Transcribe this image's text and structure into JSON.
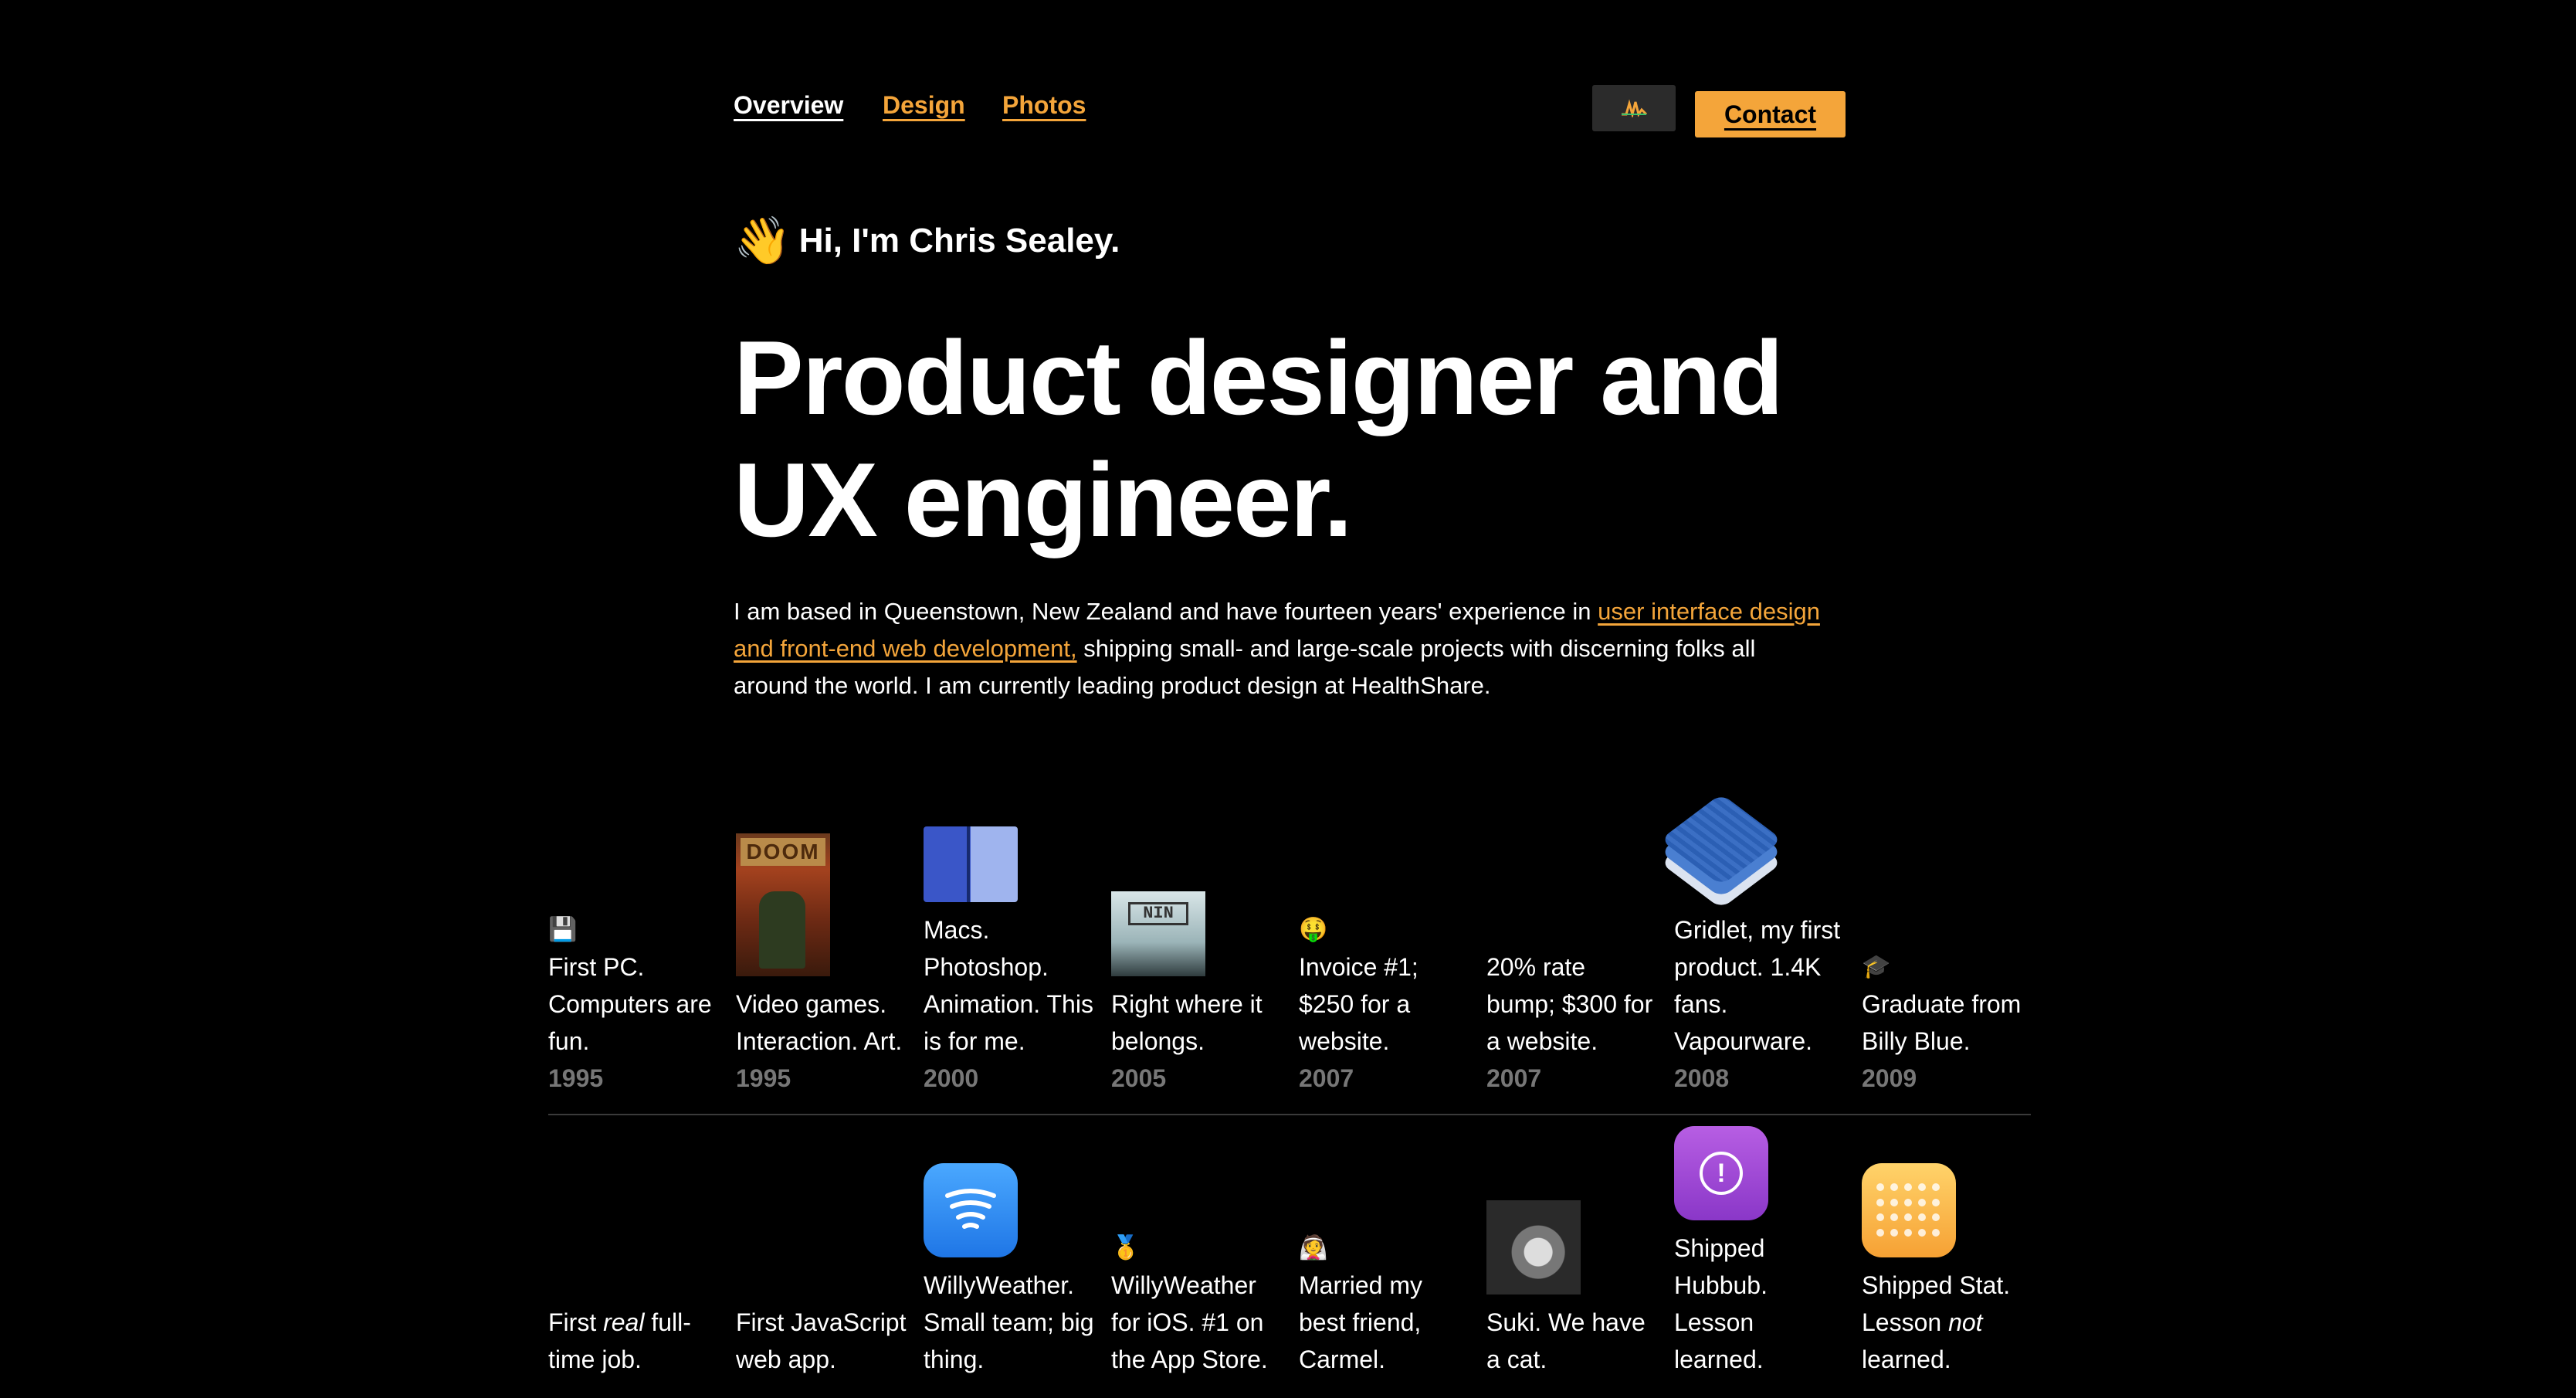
{
  "nav": {
    "items": [
      {
        "label": "Overview"
      },
      {
        "label": "Design"
      },
      {
        "label": "Photos"
      }
    ],
    "contact_label": "Contact"
  },
  "greeting": {
    "emoji": "👋",
    "text": "Hi, I'm Chris Sealey."
  },
  "headline": {
    "line1": "Product designer and",
    "line2": "UX engineer."
  },
  "intro": {
    "before": "I am based in Queenstown, New Zealand and have fourteen years' experience in ",
    "link": "user interface design and front-end web development,",
    "after": " shipping small- and large-scale projects with discerning folks all around the world. I am currently leading product design at HealthShare."
  },
  "timeline_row1": [
    {
      "emoji": "💾",
      "text": "First PC. Computers are fun.",
      "year": "1995"
    },
    {
      "text": "Video games. Interaction. Art.",
      "year": "1995",
      "image": "doom-cover"
    },
    {
      "text": "Macs. Photoshop. Animation. This is for me.",
      "year": "2000",
      "image": "finder-icon"
    },
    {
      "text": "Right where it belongs.",
      "year": "2005",
      "image": "nin-cover"
    },
    {
      "emoji": "🤑",
      "text": "Invoice #1; $250 for a website.",
      "year": "2007"
    },
    {
      "text": "20% rate bump; $300 for a website.",
      "year": "2007"
    },
    {
      "text": "Gridlet, my first product. 1.4K fans. Vapourware.",
      "year": "2008",
      "image": "gridlet-icon"
    },
    {
      "emoji": "🎓",
      "text": "Graduate from Billy Blue.",
      "year": "2009"
    }
  ],
  "timeline_row2": [
    {
      "text_before": "First ",
      "text_em": "real",
      "text_after": " full-time job."
    },
    {
      "text": "First JavaScript web app."
    },
    {
      "text": "WillyWeather. Small team; big thing.",
      "image": "willyweather-icon"
    },
    {
      "emoji": "🥇",
      "text": "WillyWeather for iOS. #1 on the App Store."
    },
    {
      "emoji": "👰",
      "text": "Married my best friend, Carmel."
    },
    {
      "text": "Suki. We have a cat.",
      "image": "cat-photo"
    },
    {
      "text": "Shipped Hubbub. Lesson learned.",
      "image": "hubbub-icon"
    },
    {
      "text_before": "Shipped Stat. Lesson ",
      "text_em": "not",
      "text_after": " learned.",
      "image": "stat-icon"
    }
  ]
}
